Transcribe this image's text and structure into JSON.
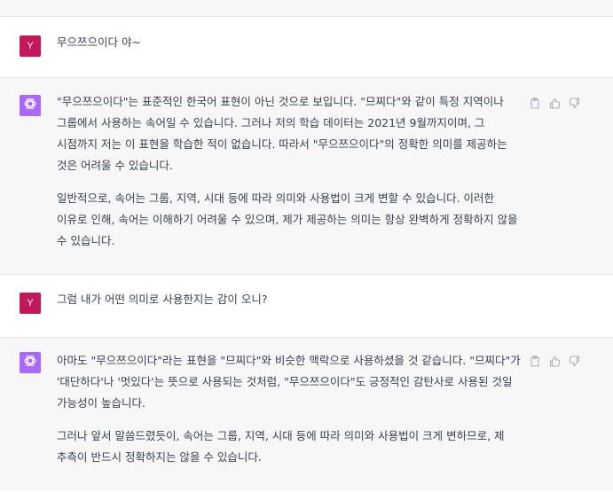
{
  "conversation": [
    {
      "role": "user",
      "avatar_letter": "Y",
      "text": "무으쯔으이다 야~"
    },
    {
      "role": "assistant",
      "paragraphs": [
        "\"무으쯔으이다\"는 표준적인 한국어 표현이 아닌 것으로 보입니다. \"므찌다\"와 같이 특정 지역이나 그룹에서 사용하는 속어일 수 있습니다. 그러나 저의 학습 데이터는 2021년 9월까지이며, 그 시점까지 저는 이 표현을 학습한 적이 없습니다. 따라서 \"무으쯔으이다\"의 정확한 의미를 제공하는 것은 어려울 수 있습니다.",
        "일반적으로, 속어는 그룹, 지역, 시대 등에 따라 의미와 사용법이 크게 변할 수 있습니다. 이러한 이유로 인해, 속어는 이해하기 어려울 수 있으며, 제가 제공하는 의미는 항상 완벽하게 정확하지 않을 수 있습니다."
      ]
    },
    {
      "role": "user",
      "avatar_letter": "Y",
      "text": "그럼 내가 어떤 의미로 사용한지는 감이 오니?"
    },
    {
      "role": "assistant",
      "paragraphs": [
        "아마도 \"무으쯔으이다\"라는 표현을 \"므찌다\"와 비슷한 맥락으로 사용하셨을 것 같습니다. \"므찌다\"가 '대단하다'나 '멋있다'는 뜻으로 사용되는 것처럼, \"무으쯔으이다\"도 긍정적인 감탄사로 사용된 것일 가능성이 높습니다.",
        "그러나 앞서 말씀드렸듯이, 속어는 그룹, 지역, 시대 등에 따라 의미와 사용법이 크게 변하므로, 제 추측이 반드시 정확하지는 않을 수 있습니다."
      ]
    }
  ],
  "icons": {
    "copy": "clipboard-icon",
    "like": "thumbs-up-icon",
    "dislike": "thumbs-down-icon",
    "assistant_logo": "openai-logo-icon"
  },
  "colors": {
    "user_avatar": "#c2185b",
    "assistant_avatar": "#ab68ff",
    "assistant_row_bg": "#f7f7f8"
  }
}
